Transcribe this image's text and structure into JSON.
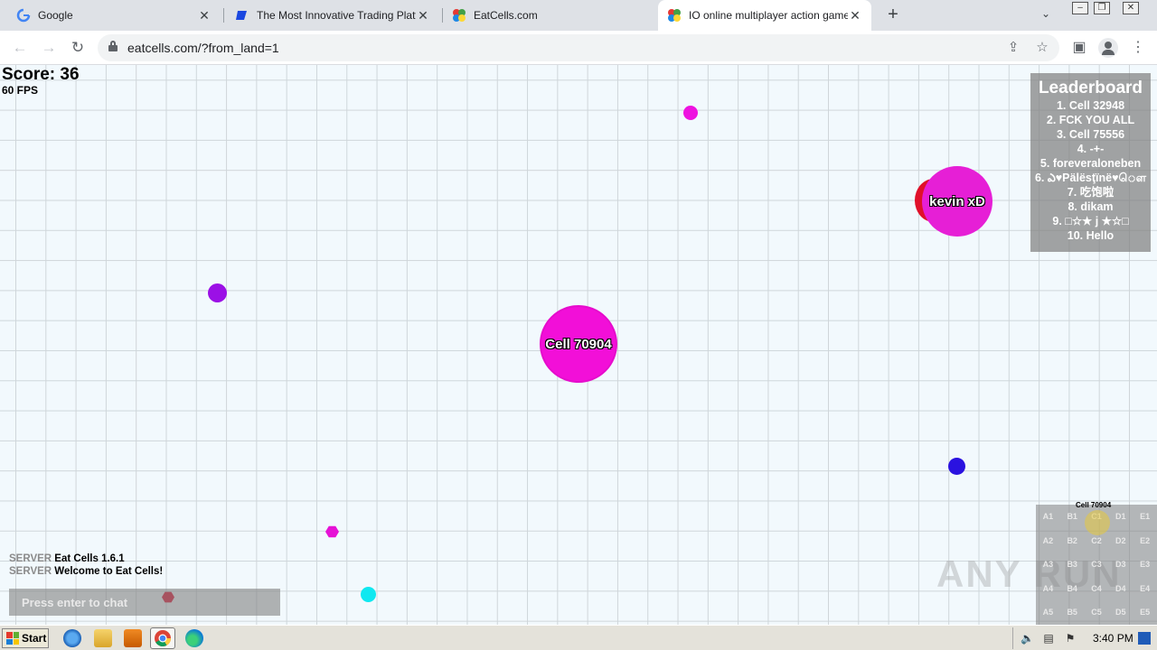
{
  "browser": {
    "tabs": [
      {
        "title": "Google",
        "icon": "google-icon"
      },
      {
        "title": "The Most Innovative Trading Platform",
        "icon": "trading-icon"
      },
      {
        "title": "EatCells.com",
        "icon": "eatcells-icon"
      },
      {
        "title": "IO online multiplayer action game. Sur",
        "icon": "eatcells-icon",
        "active": true
      }
    ],
    "url": "eatcells.com/?from_land=1"
  },
  "game": {
    "score_label": "Score: 36",
    "fps_label": "60 FPS",
    "player_cell": {
      "name": "Cell 70904",
      "color": "#f20fd8"
    },
    "enemy_cell": {
      "name": "kevin xD",
      "color": "#e61fd6"
    },
    "leaderboard": {
      "title": "Leaderboard",
      "entries": [
        "1. Cell 32948",
        "2. FCK YOU ALL",
        "3. Cell 75556",
        "4. -+-",
        "5. foreveraloneben",
        "6. ఎ♥Pälësţïnë♥ௌ",
        "7. 吃饱啦",
        "8. dikam",
        "9. □☆★ j ★☆□",
        "10. Hello"
      ]
    },
    "minimap": {
      "cells": [
        "A1",
        "B1",
        "C1",
        "D1",
        "E1",
        "A2",
        "B2",
        "C2",
        "D2",
        "E2",
        "A3",
        "B3",
        "C3",
        "D3",
        "E3",
        "A4",
        "B4",
        "C4",
        "D4",
        "E4",
        "A5",
        "B5",
        "C5",
        "D5",
        "E5"
      ],
      "player_label": "Cell 70904"
    },
    "chat": {
      "messages": [
        {
          "source": "SERVER",
          "text": "Eat Cells 1.6.1"
        },
        {
          "source": "SERVER",
          "text": "Welcome to Eat Cells!"
        }
      ],
      "placeholder": "Press enter to chat"
    },
    "watermark": "ANY RUN"
  },
  "taskbar": {
    "start_label": "Start",
    "clock": "3:40 PM"
  }
}
